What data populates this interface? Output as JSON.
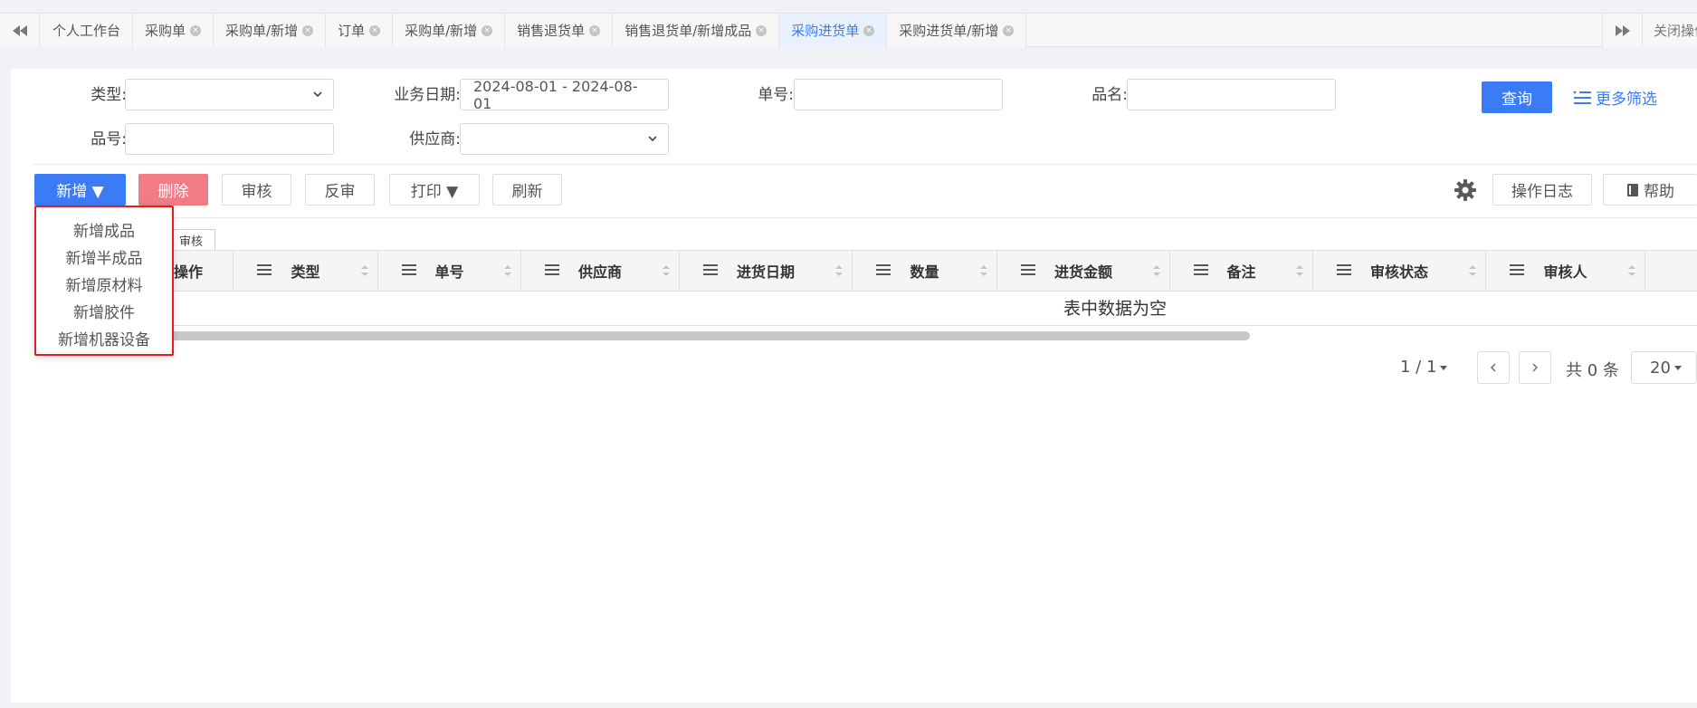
{
  "tabs": {
    "items": [
      {
        "label": "个人工作台",
        "closable": false,
        "active": false
      },
      {
        "label": "采购单",
        "closable": true,
        "active": false
      },
      {
        "label": "采购单/新增",
        "closable": true,
        "active": false
      },
      {
        "label": "订单",
        "closable": true,
        "active": false
      },
      {
        "label": "采购单/新增",
        "closable": true,
        "active": false
      },
      {
        "label": "销售退货单",
        "closable": true,
        "active": false
      },
      {
        "label": "销售退货单/新增成品",
        "closable": true,
        "active": false
      },
      {
        "label": "采购进货单",
        "closable": true,
        "active": true
      },
      {
        "label": "采购进货单/新增",
        "closable": true,
        "active": false
      }
    ],
    "close_ops_label": "关闭操作"
  },
  "filters": {
    "type_label": "类型:",
    "type_value": "",
    "date_label": "业务日期:",
    "date_value": "2024-08-01 - 2024-08-01",
    "order_no_label": "单号:",
    "order_no_value": "",
    "product_name_label": "品名:",
    "product_name_value": "",
    "product_no_label": "品号:",
    "product_no_value": "",
    "supplier_label": "供应商:",
    "supplier_value": "",
    "query_label": "查询",
    "more_filter_label": "更多筛选"
  },
  "toolbar": {
    "add_label": "新增 ▼",
    "delete_label": "删除",
    "approve_label": "审核",
    "unapprove_label": "反审",
    "print_label": "打印 ▼",
    "refresh_label": "刷新",
    "log_label": "操作日志",
    "help_label": "帮助"
  },
  "add_menu": {
    "items": [
      "新增成品",
      "新增半成品",
      "新增原材料",
      "新增胶件",
      "新增机器设备"
    ]
  },
  "subtab_label": "审核",
  "table": {
    "columns": [
      "操作",
      "类型",
      "单号",
      "供应商",
      "进货日期",
      "数量",
      "进货金额",
      "备注",
      "审核状态",
      "审核人"
    ],
    "empty_text": "表中数据为空"
  },
  "pager": {
    "page_text": "1 / 1",
    "total_text": "共 0 条",
    "page_size": "20"
  },
  "colors": {
    "accent": "#3b7bf5",
    "danger": "#f17c86",
    "highlight_border": "#e02020"
  }
}
